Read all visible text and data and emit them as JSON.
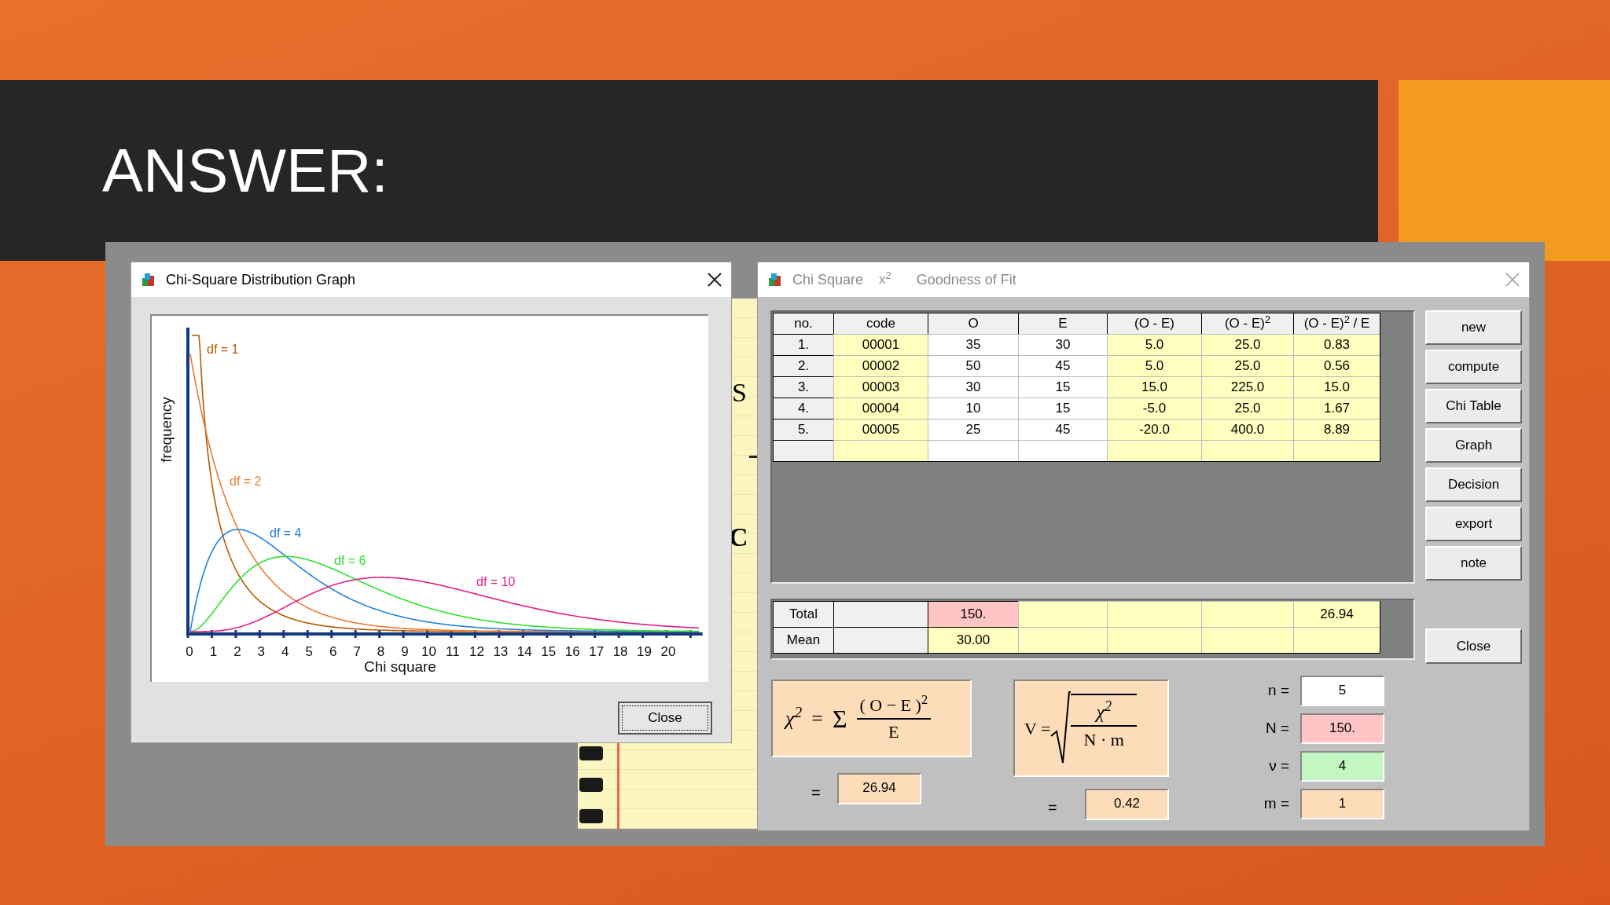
{
  "slide": {
    "title": "ANSWER:"
  },
  "note_pad": {
    "letters": [
      "S",
      "C"
    ]
  },
  "graph_window": {
    "title": "Chi-Square Distribution Graph",
    "ylabel": "frequency",
    "xlabel": "Chi square",
    "x_ticks": [
      "0",
      "1",
      "2",
      "3",
      "4",
      "5",
      "6",
      "7",
      "8",
      "9",
      "10",
      "11",
      "12",
      "13",
      "14",
      "15",
      "16",
      "17",
      "18",
      "19",
      "20"
    ],
    "curves": [
      {
        "label": "df = 1",
        "color": "#b35a00"
      },
      {
        "label": "df = 2",
        "color": "#ec7a32"
      },
      {
        "label": "df = 4",
        "color": "#1f80e0"
      },
      {
        "label": "df = 6",
        "color": "#2ee02e"
      },
      {
        "label": "df = 10",
        "color": "#e0208a"
      }
    ],
    "close_button": "Close"
  },
  "fit_window": {
    "title": "Chi Square",
    "title_symbol": "x$^{2}$",
    "subtitle": "Goodness of Fit",
    "columns": [
      "no.",
      "code",
      "O",
      "E",
      "(O - E)",
      "(O - E)$^{2}$",
      "(O - E)$^{2}$ / E"
    ],
    "rows": [
      [
        "1.",
        "00001",
        "35",
        "30",
        "5.0",
        "25.0",
        "0.83"
      ],
      [
        "2.",
        "00002",
        "50",
        "45",
        "5.0",
        "25.0",
        "0.56"
      ],
      [
        "3.",
        "00003",
        "30",
        "15",
        "15.0",
        "225.0",
        "15.0"
      ],
      [
        "4.",
        "00004",
        "10",
        "15",
        "-5.0",
        "25.0",
        "1.67"
      ],
      [
        "5.",
        "00005",
        "25",
        "45",
        "-20.0",
        "400.0",
        "8.89"
      ]
    ],
    "summary": [
      {
        "label": "Total",
        "o": "150.",
        "ratio": "26.94"
      },
      {
        "label": "Mean",
        "o": "30.00"
      }
    ],
    "buttons": [
      "new",
      "compute",
      "Chi Table",
      "Graph",
      "Decision",
      "export",
      "note"
    ],
    "close_button": "Close",
    "chi_formula": {
      "lhs": "χ$^{2}$",
      "eq": "=",
      "sum": "Σ",
      "numerator": "( O − E )$^{2}$",
      "denominator": "E"
    },
    "chi_result": {
      "eq": "=",
      "value": "26.94"
    },
    "v_formula": {
      "lhs": "V =",
      "numerator": "χ$^{2}$",
      "denominator": "N · m"
    },
    "v_result": {
      "eq": "=",
      "value": "0.42"
    },
    "params": [
      {
        "label": "n =",
        "value": "5",
        "color": "#ffffff"
      },
      {
        "label": "N =",
        "value": "150.",
        "color": "#ffc4c4"
      },
      {
        "label": "ν =",
        "value": "4",
        "color": "#c2f7c2"
      },
      {
        "label": "m =",
        "value": "1",
        "color": "#fddcb9"
      }
    ]
  }
}
